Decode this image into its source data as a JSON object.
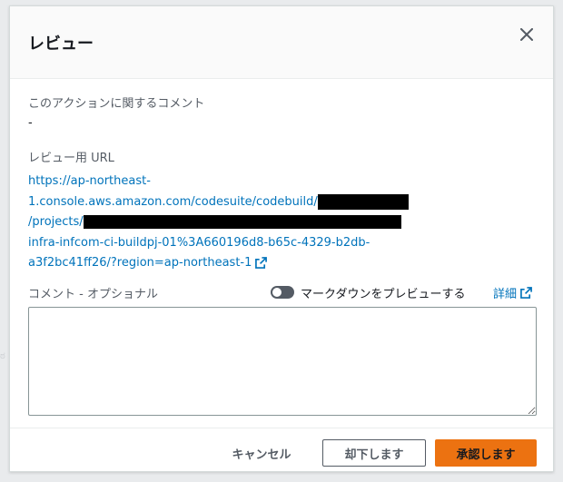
{
  "background": {
    "faint_text": "ಠ"
  },
  "modal": {
    "title": "レビュー",
    "close_icon": "close-icon"
  },
  "action_comment": {
    "label": "このアクションに関するコメント",
    "value": "-"
  },
  "review_url": {
    "label": "レビュー用 URL",
    "line1": "https://ap-northeast-",
    "line2": "1.console.aws.amazon.com/codesuite/codebuild/",
    "line3": "/projects/",
    "line4": "infra-infcom-ci-buildpj-01%3A660196d8-b65c-4329-b2db-",
    "line5": "a3f2bc41ff26/?region=ap-northeast-1"
  },
  "comment": {
    "label": "コメント - オプショナル",
    "markdown_toggle_label": "マークダウンをプレビューする",
    "detail_link": "詳細",
    "value": ""
  },
  "footer": {
    "cancel_label": "キャンセル",
    "reject_label": "却下します",
    "approve_label": "承認します"
  },
  "colors": {
    "link": "#0073bb",
    "primary_button": "#ec7211",
    "redaction": "#000000"
  }
}
